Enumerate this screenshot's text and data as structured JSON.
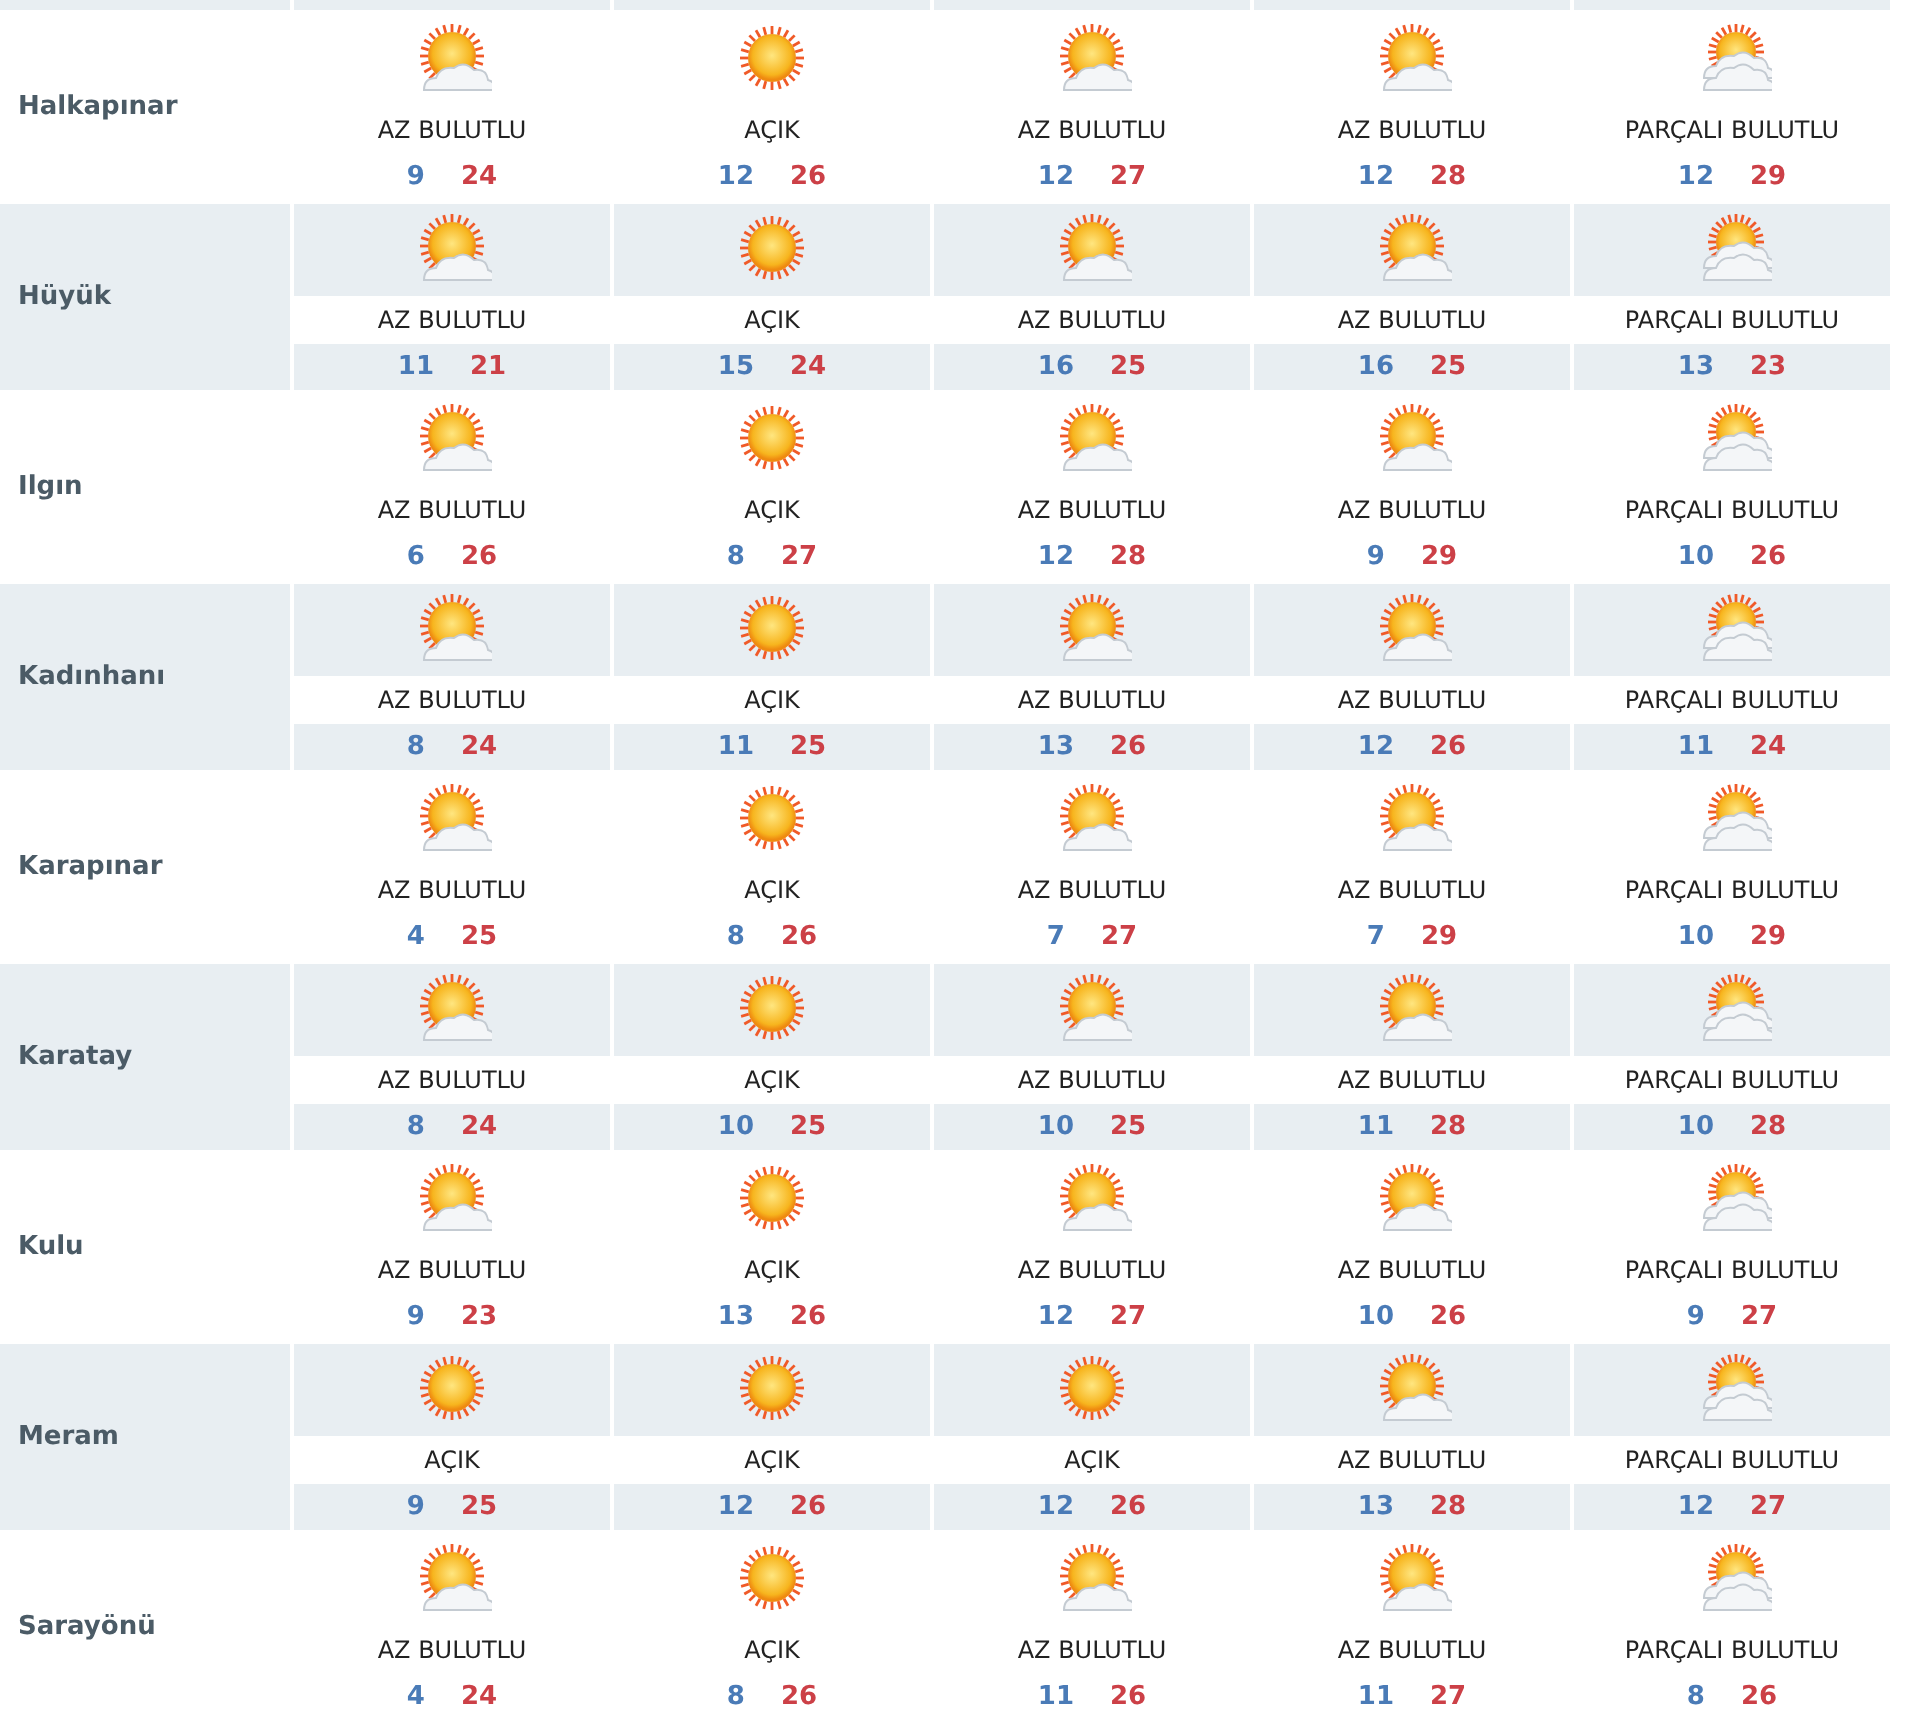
{
  "rows": [
    {
      "district": "Halkapınar",
      "days": [
        {
          "kind": "few",
          "condition": "AZ BULUTLU",
          "low": "9",
          "high": "24"
        },
        {
          "kind": "clear",
          "condition": "AÇIK",
          "low": "12",
          "high": "26"
        },
        {
          "kind": "few",
          "condition": "AZ BULUTLU",
          "low": "12",
          "high": "27"
        },
        {
          "kind": "few",
          "condition": "AZ BULUTLU",
          "low": "12",
          "high": "28"
        },
        {
          "kind": "partly",
          "condition": "PARÇALI BULUTLU",
          "low": "12",
          "high": "29"
        }
      ]
    },
    {
      "district": "Hüyük",
      "days": [
        {
          "kind": "few",
          "condition": "AZ BULUTLU",
          "low": "11",
          "high": "21"
        },
        {
          "kind": "clear",
          "condition": "AÇIK",
          "low": "15",
          "high": "24"
        },
        {
          "kind": "few",
          "condition": "AZ BULUTLU",
          "low": "16",
          "high": "25"
        },
        {
          "kind": "few",
          "condition": "AZ BULUTLU",
          "low": "16",
          "high": "25"
        },
        {
          "kind": "partly",
          "condition": "PARÇALI BULUTLU",
          "low": "13",
          "high": "23"
        }
      ]
    },
    {
      "district": "Ilgın",
      "days": [
        {
          "kind": "few",
          "condition": "AZ BULUTLU",
          "low": "6",
          "high": "26"
        },
        {
          "kind": "clear",
          "condition": "AÇIK",
          "low": "8",
          "high": "27"
        },
        {
          "kind": "few",
          "condition": "AZ BULUTLU",
          "low": "12",
          "high": "28"
        },
        {
          "kind": "few",
          "condition": "AZ BULUTLU",
          "low": "9",
          "high": "29"
        },
        {
          "kind": "partly",
          "condition": "PARÇALI BULUTLU",
          "low": "10",
          "high": "26"
        }
      ]
    },
    {
      "district": "Kadınhanı",
      "days": [
        {
          "kind": "few",
          "condition": "AZ BULUTLU",
          "low": "8",
          "high": "24"
        },
        {
          "kind": "clear",
          "condition": "AÇIK",
          "low": "11",
          "high": "25"
        },
        {
          "kind": "few",
          "condition": "AZ BULUTLU",
          "low": "13",
          "high": "26"
        },
        {
          "kind": "few",
          "condition": "AZ BULUTLU",
          "low": "12",
          "high": "26"
        },
        {
          "kind": "partly",
          "condition": "PARÇALI BULUTLU",
          "low": "11",
          "high": "24"
        }
      ]
    },
    {
      "district": "Karapınar",
      "days": [
        {
          "kind": "few",
          "condition": "AZ BULUTLU",
          "low": "4",
          "high": "25"
        },
        {
          "kind": "clear",
          "condition": "AÇIK",
          "low": "8",
          "high": "26"
        },
        {
          "kind": "few",
          "condition": "AZ BULUTLU",
          "low": "7",
          "high": "27"
        },
        {
          "kind": "few",
          "condition": "AZ BULUTLU",
          "low": "7",
          "high": "29"
        },
        {
          "kind": "partly",
          "condition": "PARÇALI BULUTLU",
          "low": "10",
          "high": "29"
        }
      ]
    },
    {
      "district": "Karatay",
      "days": [
        {
          "kind": "few",
          "condition": "AZ BULUTLU",
          "low": "8",
          "high": "24"
        },
        {
          "kind": "clear",
          "condition": "AÇIK",
          "low": "10",
          "high": "25"
        },
        {
          "kind": "few",
          "condition": "AZ BULUTLU",
          "low": "10",
          "high": "25"
        },
        {
          "kind": "few",
          "condition": "AZ BULUTLU",
          "low": "11",
          "high": "28"
        },
        {
          "kind": "partly",
          "condition": "PARÇALI BULUTLU",
          "low": "10",
          "high": "28"
        }
      ]
    },
    {
      "district": "Kulu",
      "days": [
        {
          "kind": "few",
          "condition": "AZ BULUTLU",
          "low": "9",
          "high": "23"
        },
        {
          "kind": "clear",
          "condition": "AÇIK",
          "low": "13",
          "high": "26"
        },
        {
          "kind": "few",
          "condition": "AZ BULUTLU",
          "low": "12",
          "high": "27"
        },
        {
          "kind": "few",
          "condition": "AZ BULUTLU",
          "low": "10",
          "high": "26"
        },
        {
          "kind": "partly",
          "condition": "PARÇALI BULUTLU",
          "low": "9",
          "high": "27"
        }
      ]
    },
    {
      "district": "Meram",
      "days": [
        {
          "kind": "clear",
          "condition": "AÇIK",
          "low": "9",
          "high": "25"
        },
        {
          "kind": "clear",
          "condition": "AÇIK",
          "low": "12",
          "high": "26"
        },
        {
          "kind": "clear",
          "condition": "AÇIK",
          "low": "12",
          "high": "26"
        },
        {
          "kind": "few",
          "condition": "AZ BULUTLU",
          "low": "13",
          "high": "28"
        },
        {
          "kind": "partly",
          "condition": "PARÇALI BULUTLU",
          "low": "12",
          "high": "27"
        }
      ]
    },
    {
      "district": "Sarayönü",
      "days": [
        {
          "kind": "few",
          "condition": "AZ BULUTLU",
          "low": "4",
          "high": "24"
        },
        {
          "kind": "clear",
          "condition": "AÇIK",
          "low": "8",
          "high": "26"
        },
        {
          "kind": "few",
          "condition": "AZ BULUTLU",
          "low": "11",
          "high": "26"
        },
        {
          "kind": "few",
          "condition": "AZ BULUTLU",
          "low": "11",
          "high": "27"
        },
        {
          "kind": "partly",
          "condition": "PARÇALI BULUTLU",
          "low": "8",
          "high": "26"
        }
      ]
    }
  ]
}
